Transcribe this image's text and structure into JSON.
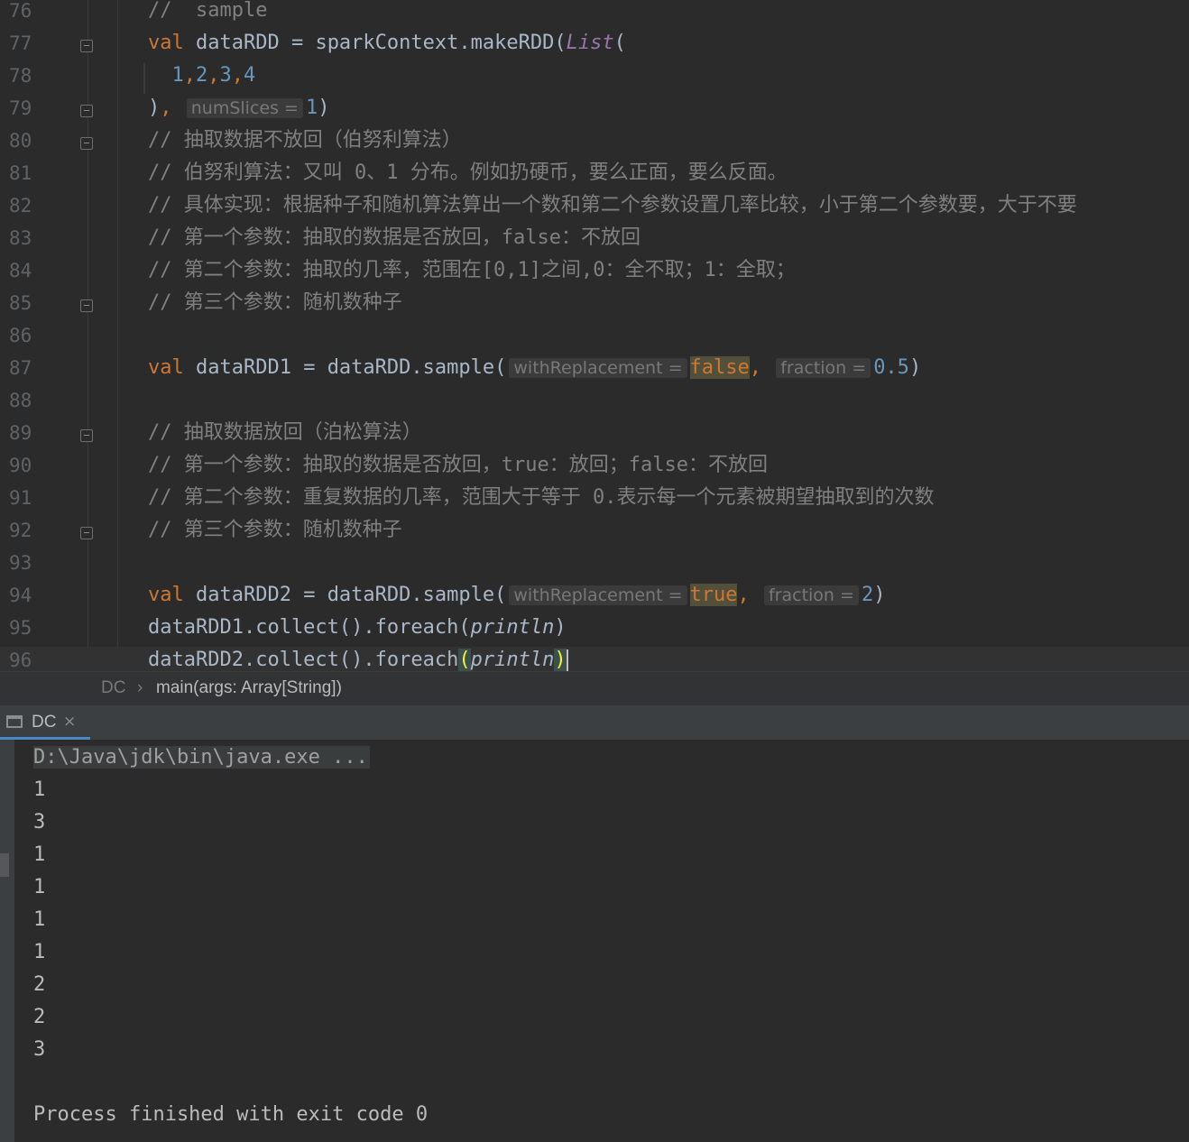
{
  "editor": {
    "lines": [
      {
        "num": "76",
        "code": [
          {
            "t": "//  sample",
            "c": "cmt"
          }
        ]
      },
      {
        "num": "77",
        "code": [
          {
            "t": "val",
            "c": "kw"
          },
          {
            "t": " dataRDD = sparkContext.makeRDD("
          },
          {
            "t": "List",
            "c": "cls"
          },
          {
            "t": "("
          }
        ]
      },
      {
        "num": "78",
        "code": [
          {
            "t": "  "
          },
          {
            "t": "1",
            "c": "num"
          },
          {
            "t": ",",
            "c": "kw"
          },
          {
            "t": "2",
            "c": "num"
          },
          {
            "t": ",",
            "c": "kw"
          },
          {
            "t": "3",
            "c": "num"
          },
          {
            "t": ",",
            "c": "kw"
          },
          {
            "t": "4",
            "c": "num"
          }
        ]
      },
      {
        "num": "79",
        "code": [
          {
            "t": ")"
          },
          {
            "t": ",",
            "c": "kw"
          },
          {
            "t": " "
          },
          {
            "t": "numSlices =",
            "c": "hint"
          },
          {
            "t": "1",
            "c": "num"
          },
          {
            "t": ")"
          }
        ]
      },
      {
        "num": "80",
        "code": [
          {
            "t": "// 抽取数据不放回（伯努利算法）",
            "c": "cmt"
          }
        ]
      },
      {
        "num": "81",
        "code": [
          {
            "t": "// 伯努利算法：又叫 0、1 分布。例如扔硬币，要么正面，要么反面。",
            "c": "cmt"
          }
        ]
      },
      {
        "num": "82",
        "code": [
          {
            "t": "// 具体实现：根据种子和随机算法算出一个数和第二个参数设置几率比较，小于第二个参数要，大于不要",
            "c": "cmt"
          }
        ]
      },
      {
        "num": "83",
        "code": [
          {
            "t": "// 第一个参数：抽取的数据是否放回，false：不放回",
            "c": "cmt"
          }
        ]
      },
      {
        "num": "84",
        "code": [
          {
            "t": "// 第二个参数：抽取的几率，范围在[0,1]之间,0：全不取；1：全取；",
            "c": "cmt"
          }
        ]
      },
      {
        "num": "85",
        "code": [
          {
            "t": "// 第三个参数：随机数种子",
            "c": "cmt"
          }
        ]
      },
      {
        "num": "86",
        "code": []
      },
      {
        "num": "87",
        "code": [
          {
            "t": "val",
            "c": "kw"
          },
          {
            "t": " dataRDD1 = dataRDD.sample("
          },
          {
            "t": "withReplacement =",
            "c": "hint"
          },
          {
            "t": "false",
            "c": "kw hl"
          },
          {
            "t": ",",
            "c": "kw"
          },
          {
            "t": " "
          },
          {
            "t": "fraction =",
            "c": "hint"
          },
          {
            "t": "0.5",
            "c": "num"
          },
          {
            "t": ")"
          }
        ]
      },
      {
        "num": "88",
        "code": []
      },
      {
        "num": "89",
        "code": [
          {
            "t": "// 抽取数据放回（泊松算法）",
            "c": "cmt"
          }
        ]
      },
      {
        "num": "90",
        "code": [
          {
            "t": "// 第一个参数：抽取的数据是否放回，true：放回；false：不放回",
            "c": "cmt"
          }
        ]
      },
      {
        "num": "91",
        "code": [
          {
            "t": "// 第二个参数：重复数据的几率，范围大于等于 0.表示每一个元素被期望抽取到的次数",
            "c": "cmt"
          }
        ]
      },
      {
        "num": "92",
        "code": [
          {
            "t": "// 第三个参数：随机数种子",
            "c": "cmt"
          }
        ]
      },
      {
        "num": "93",
        "code": []
      },
      {
        "num": "94",
        "code": [
          {
            "t": "val",
            "c": "kw"
          },
          {
            "t": " dataRDD2 = dataRDD.sample("
          },
          {
            "t": "withReplacement =",
            "c": "hint"
          },
          {
            "t": "true",
            "c": "kw hl"
          },
          {
            "t": ",",
            "c": "kw"
          },
          {
            "t": " "
          },
          {
            "t": "fraction =",
            "c": "hint"
          },
          {
            "t": "2",
            "c": "num"
          },
          {
            "t": ")"
          }
        ]
      },
      {
        "num": "95",
        "code": [
          {
            "t": "dataRDD1.collect().foreach("
          },
          {
            "t": "println",
            "c": "fn"
          },
          {
            "t": ")"
          }
        ]
      },
      {
        "num": "96",
        "code": [
          {
            "t": "dataRDD2.collect().foreach"
          },
          {
            "t": "(",
            "c": "caretmatch"
          },
          {
            "t": "println",
            "c": "fn"
          },
          {
            "t": ")",
            "c": "caretmatch"
          }
        ]
      }
    ]
  },
  "breadcrumb": {
    "class": "DC",
    "separator": "›",
    "method": "main(args: Array[String])"
  },
  "run_panel": {
    "tab_label": "DC",
    "close": "×"
  },
  "console": {
    "command": "D:\\Java\\jdk\\bin\\java.exe ...",
    "output": [
      "1",
      "3",
      "1",
      "1",
      "1",
      "1",
      "2",
      "2",
      "3"
    ],
    "finish": "Process finished with exit code 0"
  }
}
